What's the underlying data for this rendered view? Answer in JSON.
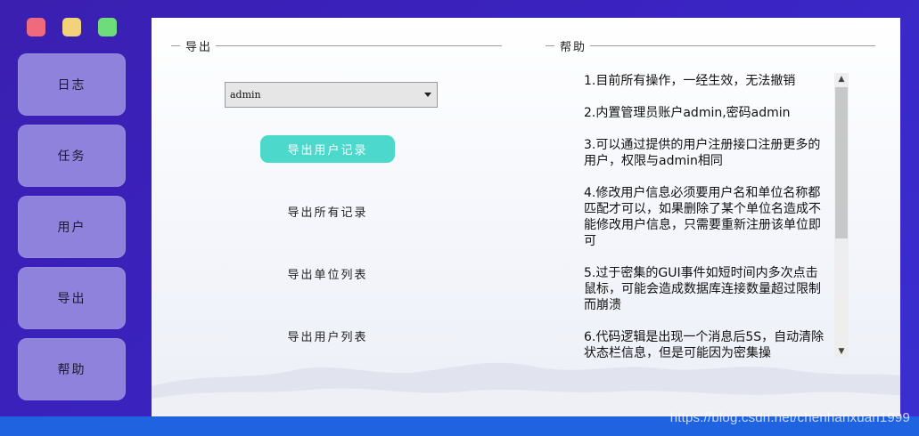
{
  "window": {
    "controls": [
      "close",
      "minimize",
      "maximize"
    ],
    "colors": {
      "close": "#ee6a7c",
      "minimize": "#f2d27a",
      "maximize": "#6fdc7c"
    }
  },
  "sidebar": {
    "items": [
      {
        "label": "日志"
      },
      {
        "label": "任务"
      },
      {
        "label": "用户"
      },
      {
        "label": "导出"
      },
      {
        "label": "帮助"
      }
    ]
  },
  "export": {
    "group_title": "导出",
    "user_select": {
      "value": "admin"
    },
    "export_user_records": "导出用户记录",
    "export_all_records": "导出所有记录",
    "export_unit_list": "导出单位列表",
    "export_user_list": "导出用户列表"
  },
  "help": {
    "group_title": "帮助",
    "items": [
      "1.目前所有操作，一经生效，无法撤销",
      "2.内置管理员账户admin,密码admin",
      "3.可以通过提供的用户注册接口注册更多的用户，权限与admin相同",
      "4.修改用户信息必须要用户名和单位名称都匹配才可以，如果删除了某个单位名造成不能修改用户信息，只需要重新注册该单位即可",
      "5.过于密集的GUI事件如短时间内多次点击鼠标，可能会造成数据库连接数量超过限制而崩溃",
      "6.代码逻辑是出现一个消息后5S，自动清除状态栏信息，但是可能因为密集操"
    ]
  },
  "watermark": "https://blog.csdn.net/chenhanxuan1999"
}
